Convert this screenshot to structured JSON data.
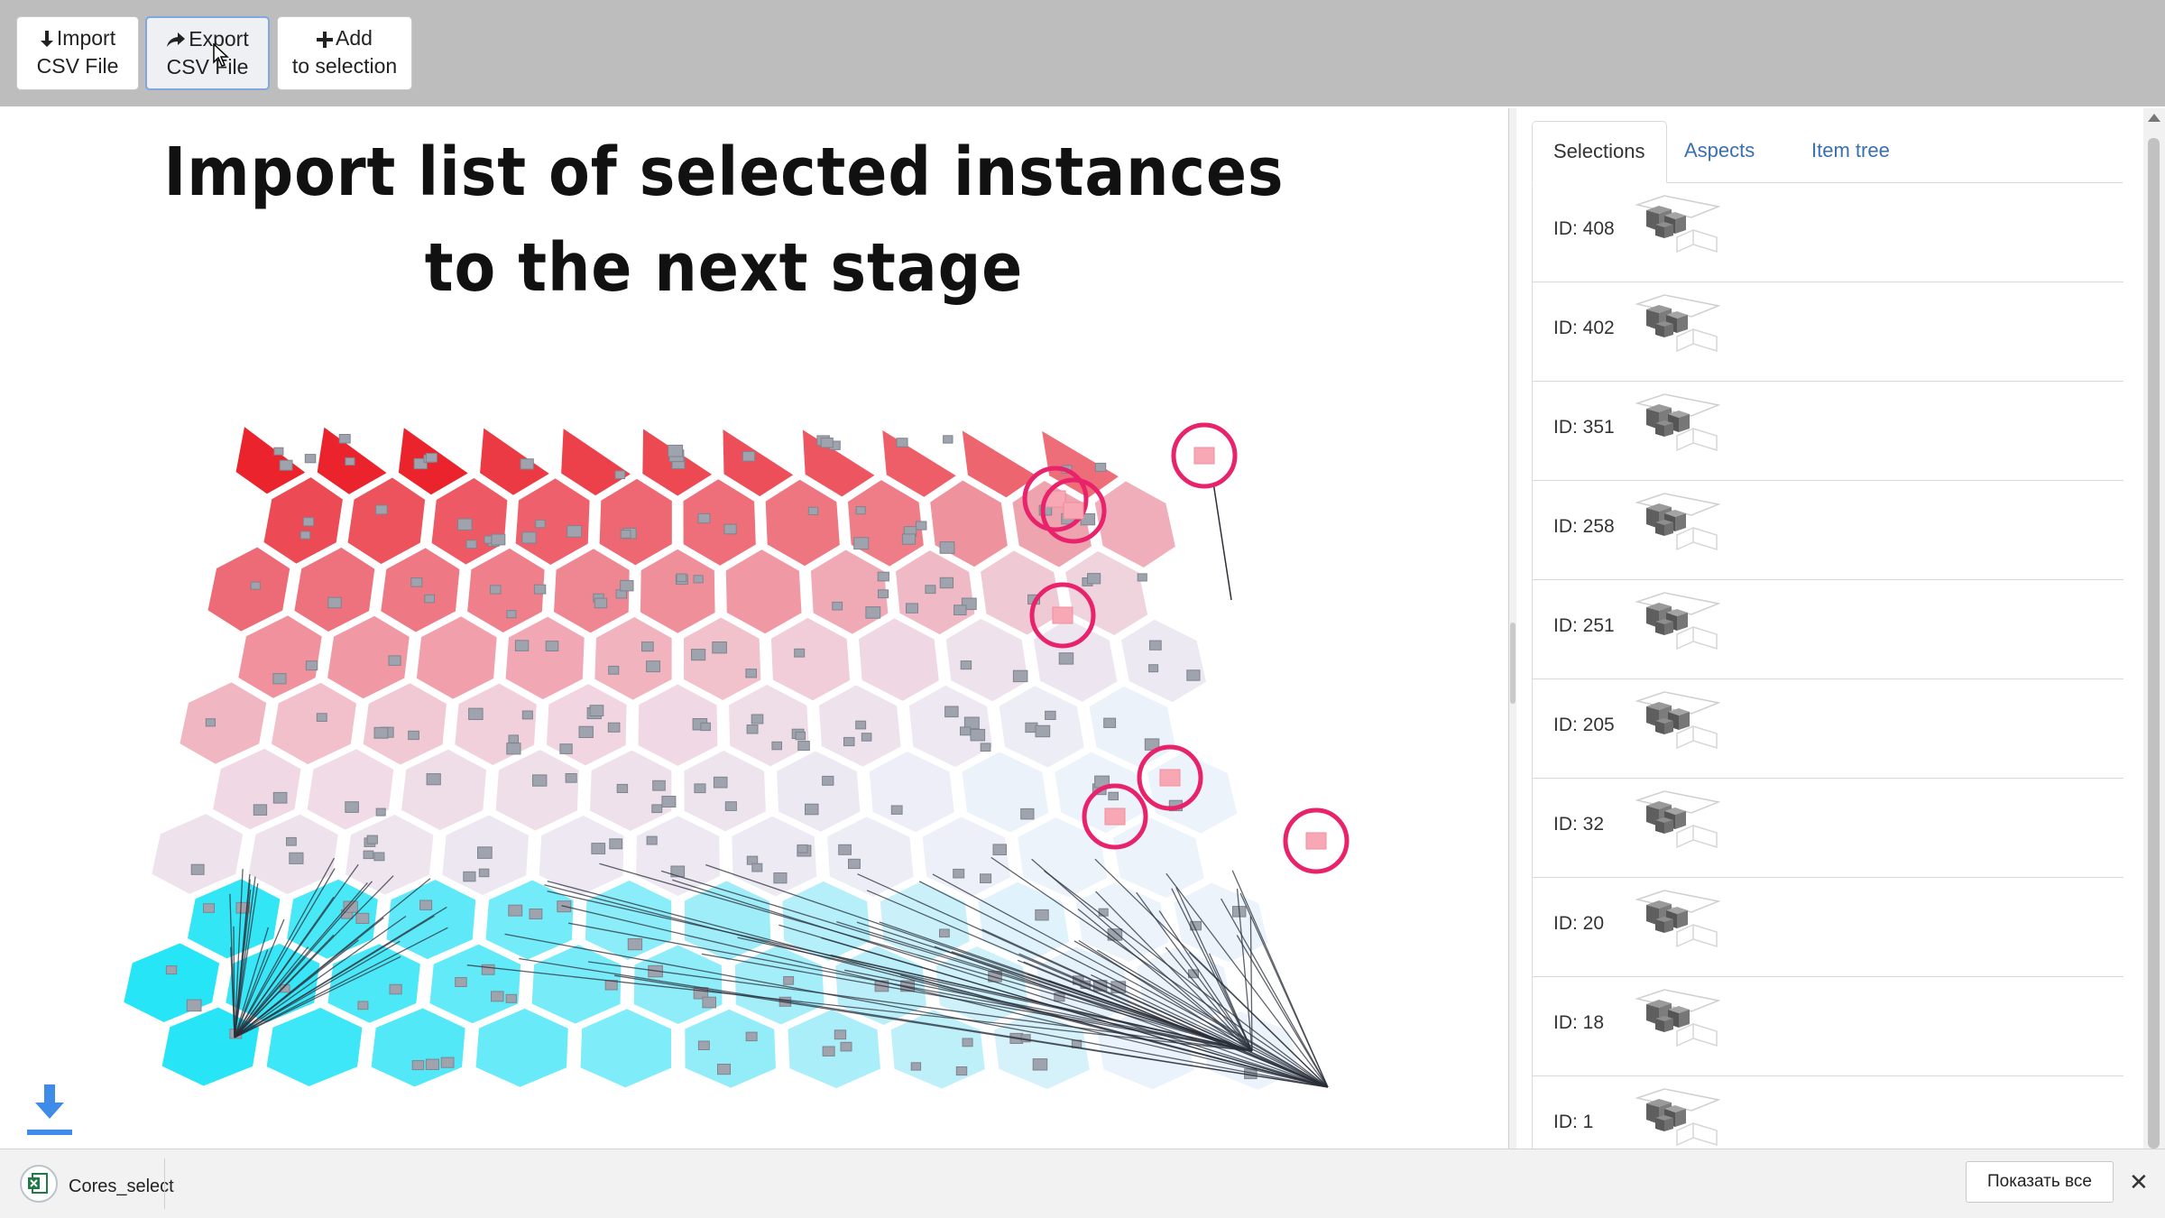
{
  "toolbar": {
    "import_line1": "Import",
    "import_line2": "CSV File",
    "export_line1": "Export",
    "export_line2": "CSV File",
    "add_line1": "Add",
    "add_line2": "to selection"
  },
  "visualization": {
    "title_line1": "Import list of selected instances",
    "title_line2": "to the next stage",
    "colors": {
      "high": "#e8101a",
      "mid": "#f2c6d4",
      "neutral": "#eaf2fb",
      "low": "#12e3f5",
      "selection_ring": "#e8226b",
      "link_lines": "#2a2f3a"
    }
  },
  "side_panel": {
    "tabs": [
      {
        "label": "Selections",
        "active": true
      },
      {
        "label": "Aspects",
        "active": false
      },
      {
        "label": "Item tree",
        "active": false
      }
    ],
    "items": [
      {
        "label": "ID: 408"
      },
      {
        "label": "ID: 402"
      },
      {
        "label": "ID: 351"
      },
      {
        "label": "ID: 258"
      },
      {
        "label": "ID: 251"
      },
      {
        "label": "ID: 205"
      },
      {
        "label": "ID: 32"
      },
      {
        "label": "ID: 20"
      },
      {
        "label": "ID: 18"
      },
      {
        "label": "ID: 1"
      }
    ]
  },
  "download_bar": {
    "filename": "Cores_select",
    "show_all_label": "Показать все",
    "close_icon": "close-icon"
  }
}
